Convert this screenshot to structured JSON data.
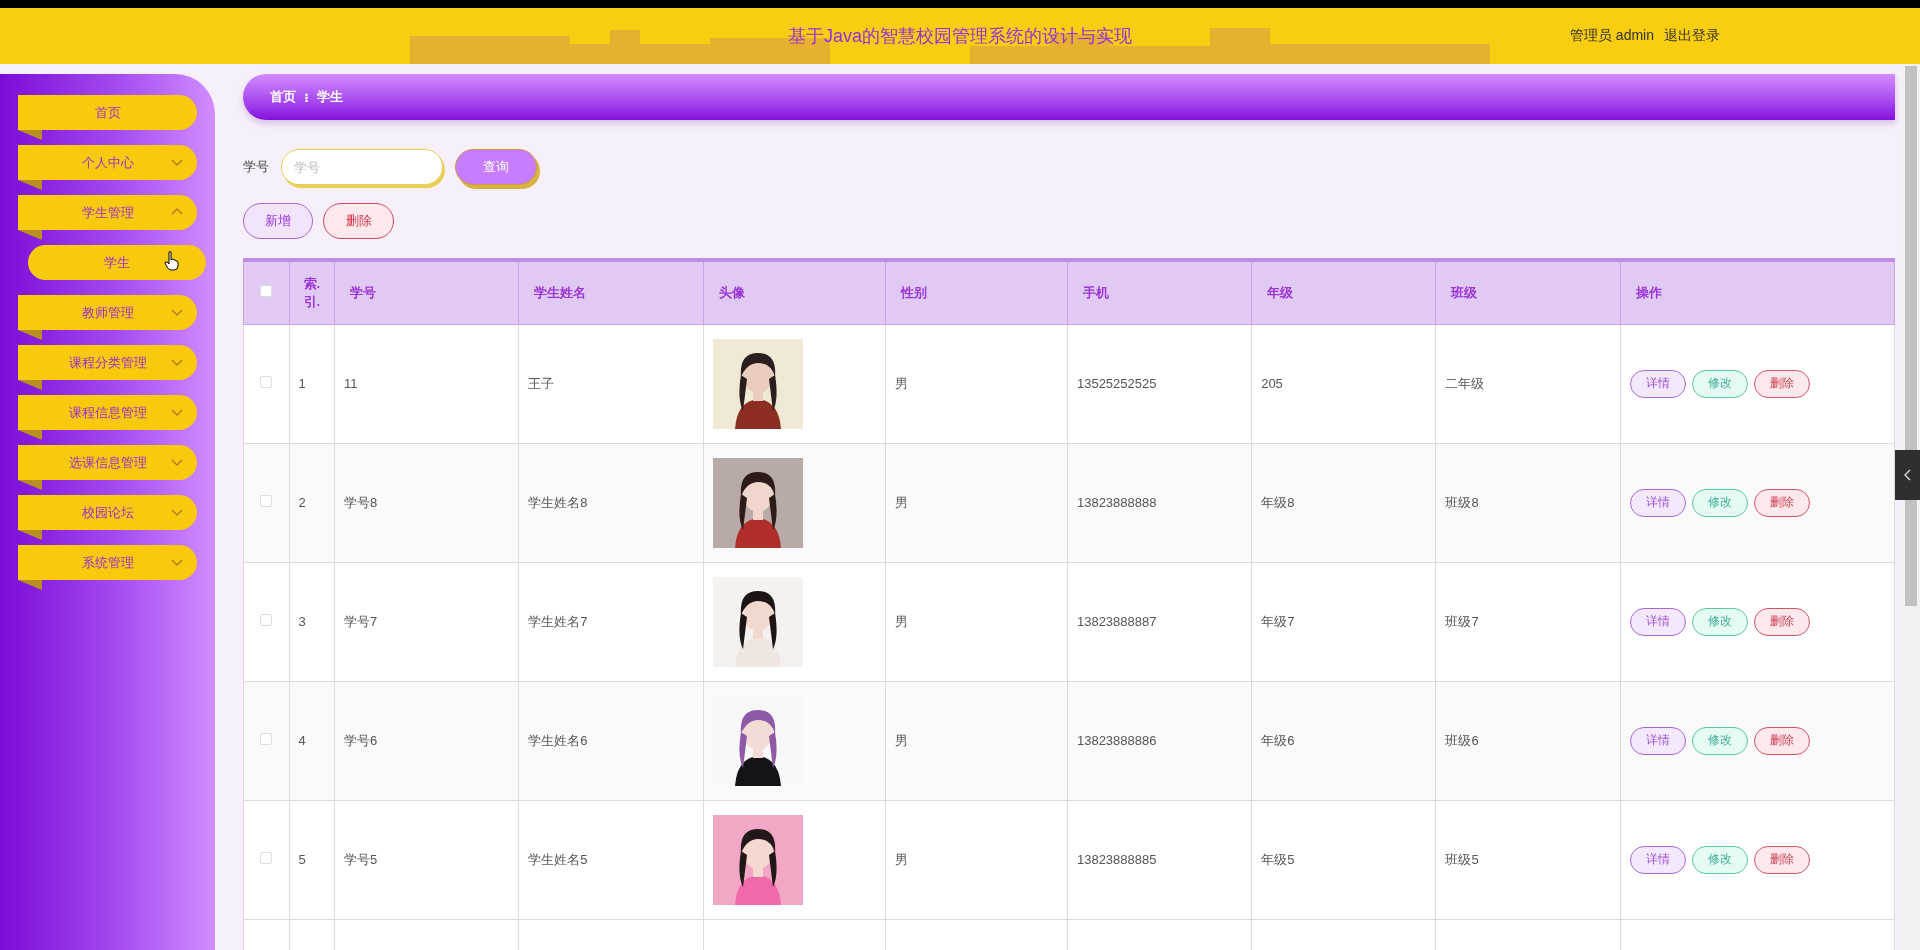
{
  "header": {
    "title": "基于Java的智慧校园管理系统的设计与实现",
    "user": "管理员 admin",
    "logout": "退出登录"
  },
  "sidebar": {
    "items": [
      {
        "label": "首页"
      },
      {
        "label": "个人中心",
        "expanded": false
      },
      {
        "label": "学生管理",
        "expanded": true,
        "children": [
          {
            "label": "学生",
            "selected": true
          }
        ]
      },
      {
        "label": "教师管理",
        "expanded": false
      },
      {
        "label": "课程分类管理",
        "expanded": false
      },
      {
        "label": "课程信息管理",
        "expanded": false
      },
      {
        "label": "选课信息管理",
        "expanded": false
      },
      {
        "label": "校园论坛",
        "expanded": false
      },
      {
        "label": "系统管理",
        "expanded": false
      }
    ]
  },
  "breadcrumb": {
    "items": [
      "首页",
      "学生"
    ],
    "separator": "⁝"
  },
  "search": {
    "label": "学号",
    "placeholder": "学号",
    "button": "查询"
  },
  "actions": [
    "新增",
    "删除"
  ],
  "table": {
    "select_all_checked": false,
    "columns": [
      "索.引.",
      "学号",
      "学生姓名",
      "头像",
      "性别",
      "手机",
      "年级",
      "班级",
      "操作"
    ],
    "rows": [
      {
        "checked": false,
        "index": "1",
        "student_no": "11",
        "name": "王子",
        "gender": "男",
        "phone": "13525252525",
        "grade": "205",
        "class": "二年级",
        "ops": [
          "详情",
          "修改",
          "删除"
        ]
      },
      {
        "checked": false,
        "index": "2",
        "student_no": "学号8",
        "name": "学生姓名8",
        "gender": "男",
        "phone": "13823888888",
        "grade": "年级8",
        "class": "班级8",
        "ops": [
          "详情",
          "修改",
          "删除"
        ]
      },
      {
        "checked": false,
        "index": "3",
        "student_no": "学号7",
        "name": "学生姓名7",
        "gender": "男",
        "phone": "13823888887",
        "grade": "年级7",
        "class": "班级7",
        "ops": [
          "详情",
          "修改",
          "删除"
        ]
      },
      {
        "checked": false,
        "index": "4",
        "student_no": "学号6",
        "name": "学生姓名6",
        "gender": "男",
        "phone": "13823888886",
        "grade": "年级6",
        "class": "班级6",
        "ops": [
          "详情",
          "修改",
          "删除"
        ]
      },
      {
        "checked": false,
        "index": "5",
        "student_no": "学号5",
        "name": "学生姓名5",
        "gender": "男",
        "phone": "13823888885",
        "grade": "年级5",
        "class": "班级5",
        "ops": [
          "详情",
          "修改",
          "删除"
        ]
      }
    ]
  }
}
